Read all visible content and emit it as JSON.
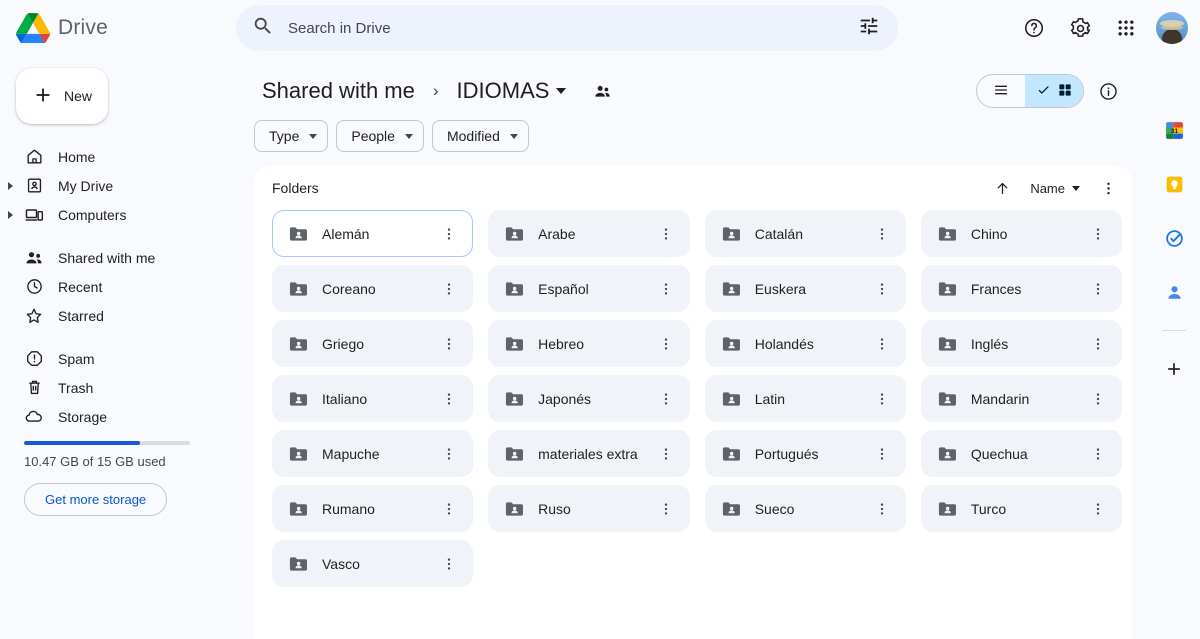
{
  "app": {
    "brand_name": "Drive",
    "logo_icon": "google-drive-logo"
  },
  "search": {
    "placeholder": "Search in Drive",
    "value": "",
    "search_icon": "search-icon",
    "filter_icon": "tune-icon"
  },
  "topbar_actions": [
    {
      "name": "help-button",
      "icon": "help-circle-icon",
      "label": "Help"
    },
    {
      "name": "settings-button",
      "icon": "gear-icon",
      "label": "Settings"
    },
    {
      "name": "apps-button",
      "icon": "apps-grid-icon",
      "label": "Google apps"
    }
  ],
  "account": {
    "avatar_label": "Account"
  },
  "sidebar": {
    "new_button": {
      "label": "New",
      "icon": "plus-icon"
    },
    "items": [
      {
        "label": "Home",
        "icon": "home-icon",
        "expandable": false
      },
      {
        "label": "My Drive",
        "icon": "my-drive-icon",
        "expandable": true
      },
      {
        "label": "Computers",
        "icon": "computers-icon",
        "expandable": true
      },
      {
        "label": "Shared with me",
        "icon": "people-icon",
        "expandable": false
      },
      {
        "label": "Recent",
        "icon": "clock-icon",
        "expandable": false
      },
      {
        "label": "Starred",
        "icon": "star-icon",
        "expandable": false
      },
      {
        "label": "Spam",
        "icon": "spam-icon",
        "expandable": false
      },
      {
        "label": "Trash",
        "icon": "trash-icon",
        "expandable": false
      },
      {
        "label": "Storage",
        "icon": "cloud-icon",
        "expandable": false
      }
    ],
    "storage": {
      "used_percent": 70,
      "usage_text": "10.47 GB of 15 GB used",
      "cta_label": "Get more storage"
    }
  },
  "header": {
    "breadcrumb_parent": "Shared with me",
    "breadcrumb_separator": "›",
    "breadcrumb_current": "IDIOMAS",
    "shared_icon": "people-shared-icon",
    "view_toggle": {
      "list_label": "List view",
      "list_icon": "list-view-icon",
      "grid_label": "Grid view",
      "grid_icon": "grid-view-icon",
      "active": "grid",
      "check_icon": "check-icon",
      "active_bg": "#c2e7ff"
    },
    "info_button": {
      "label": "View details",
      "icon": "info-circle-icon"
    }
  },
  "filters": [
    {
      "label": "Type",
      "icon": "chevron-down-icon"
    },
    {
      "label": "People",
      "icon": "chevron-down-icon"
    },
    {
      "label": "Modified",
      "icon": "chevron-down-icon"
    }
  ],
  "content": {
    "section_title": "Folders",
    "sort": {
      "direction_icon": "arrow-up-icon",
      "field_label": "Name",
      "chevron_icon": "chevron-down-icon"
    },
    "more_options": {
      "label": "More options",
      "icon": "kebab-menu-icon"
    },
    "folder_icon": "shared-folder-icon",
    "item_menu_icon": "kebab-menu-icon",
    "selected_index": 0,
    "folders": [
      {
        "name": "Alemán"
      },
      {
        "name": "Arabe"
      },
      {
        "name": "Catalán"
      },
      {
        "name": "Chino"
      },
      {
        "name": "Coreano"
      },
      {
        "name": "Español"
      },
      {
        "name": "Euskera"
      },
      {
        "name": "Frances"
      },
      {
        "name": "Griego"
      },
      {
        "name": "Hebreo"
      },
      {
        "name": "Holandés"
      },
      {
        "name": "Inglés"
      },
      {
        "name": "Italiano"
      },
      {
        "name": "Japonés"
      },
      {
        "name": "Latin"
      },
      {
        "name": "Mandarin"
      },
      {
        "name": "Mapuche"
      },
      {
        "name": "materiales extra"
      },
      {
        "name": "Portugués"
      },
      {
        "name": "Quechua"
      },
      {
        "name": "Rumano"
      },
      {
        "name": "Ruso"
      },
      {
        "name": "Sueco"
      },
      {
        "name": "Turco"
      },
      {
        "name": "Vasco"
      }
    ]
  },
  "side_rail": {
    "apps": [
      {
        "name": "google-calendar-icon",
        "label": "Calendar",
        "day": "31"
      },
      {
        "name": "google-keep-icon",
        "label": "Keep"
      },
      {
        "name": "google-tasks-icon",
        "label": "Tasks"
      },
      {
        "name": "google-contacts-icon",
        "label": "Contacts"
      }
    ],
    "add_button": {
      "label": "Get add-ons",
      "icon": "plus-icon"
    }
  }
}
